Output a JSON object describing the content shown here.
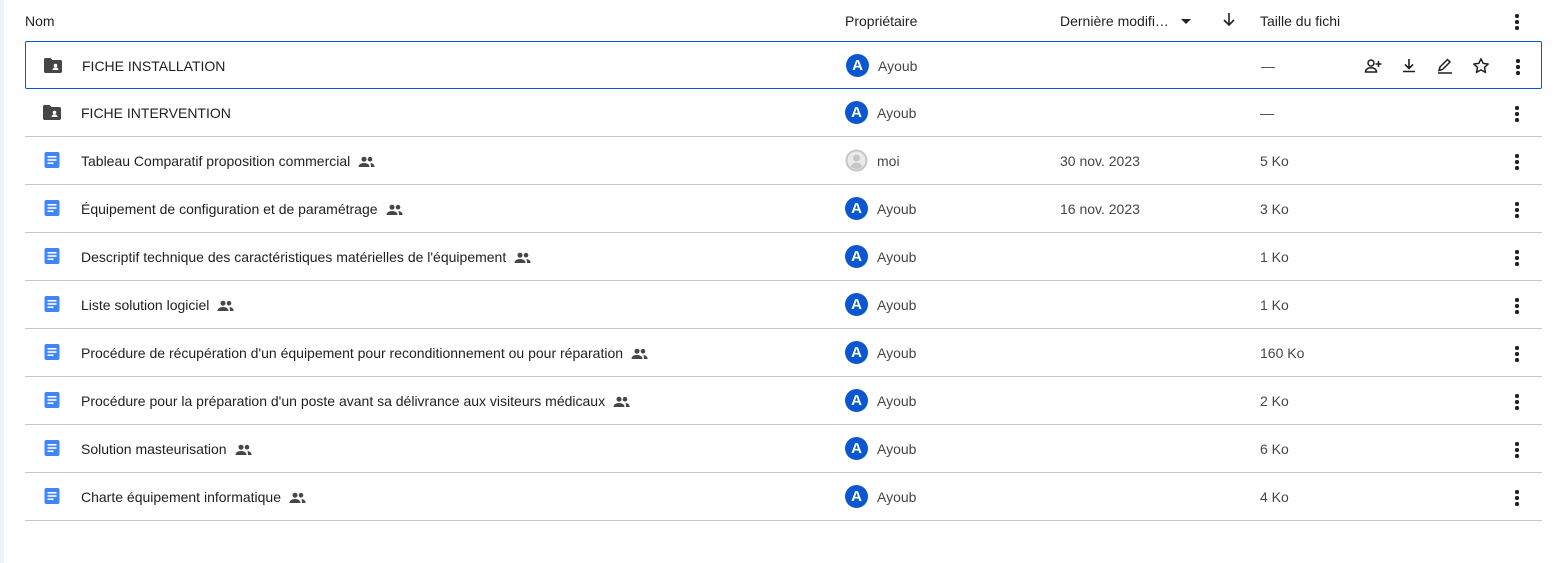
{
  "header": {
    "name_label": "Nom",
    "owner_label": "Propriétaire",
    "modified_label": "Dernière modifi…",
    "size_label": "Taille du fichi"
  },
  "rows": [
    {
      "type": "folder-shared",
      "name": "FICHE INSTALLATION",
      "shared": false,
      "owner_initial": "A",
      "owner": "Ayoub",
      "modified": "",
      "size": "—",
      "selected": true
    },
    {
      "type": "folder-shared",
      "name": "FICHE INTERVENTION",
      "shared": false,
      "owner_initial": "A",
      "owner": "Ayoub",
      "modified": "",
      "size": "—",
      "selected": false
    },
    {
      "type": "doc",
      "name": "Tableau Comparatif proposition commercial",
      "shared": true,
      "owner_initial": "",
      "owner": "moi",
      "modified": "30 nov. 2023",
      "size": "5 Ko",
      "selected": false
    },
    {
      "type": "doc",
      "name": "Équipement de configuration et de paramétrage",
      "shared": true,
      "owner_initial": "A",
      "owner": "Ayoub",
      "modified": "16 nov. 2023",
      "size": "3 Ko",
      "selected": false
    },
    {
      "type": "doc",
      "name": "Descriptif technique des caractéristiques matérielles de l'équipement",
      "shared": true,
      "owner_initial": "A",
      "owner": "Ayoub",
      "modified": "",
      "size": "1 Ko",
      "selected": false
    },
    {
      "type": "doc",
      "name": "Liste solution logiciel",
      "shared": true,
      "owner_initial": "A",
      "owner": "Ayoub",
      "modified": "",
      "size": "1 Ko",
      "selected": false
    },
    {
      "type": "doc",
      "name": "Procédure de récupération d'un équipement pour reconditionnement ou pour réparation",
      "shared": true,
      "owner_initial": "A",
      "owner": "Ayoub",
      "modified": "",
      "size": "160 Ko",
      "selected": false
    },
    {
      "type": "doc",
      "name": "Procédure pour la préparation d'un poste avant sa délivrance aux visiteurs médicaux",
      "shared": true,
      "owner_initial": "A",
      "owner": "Ayoub",
      "modified": "",
      "size": "2 Ko",
      "selected": false
    },
    {
      "type": "doc",
      "name": "Solution masteurisation",
      "shared": true,
      "owner_initial": "A",
      "owner": "Ayoub",
      "modified": "",
      "size": "6 Ko",
      "selected": false
    },
    {
      "type": "doc",
      "name": "Charte équipement informatique",
      "shared": true,
      "owner_initial": "A",
      "owner": "Ayoub",
      "modified": "",
      "size": "4 Ko",
      "selected": false
    }
  ],
  "row_actions": [
    "share-icon",
    "download-icon",
    "rename-icon",
    "star-icon"
  ],
  "colors": {
    "accent": "#0b57d0",
    "doc_blue": "#4285f4",
    "folder": "#444746",
    "divider": "#c4c7c5"
  }
}
